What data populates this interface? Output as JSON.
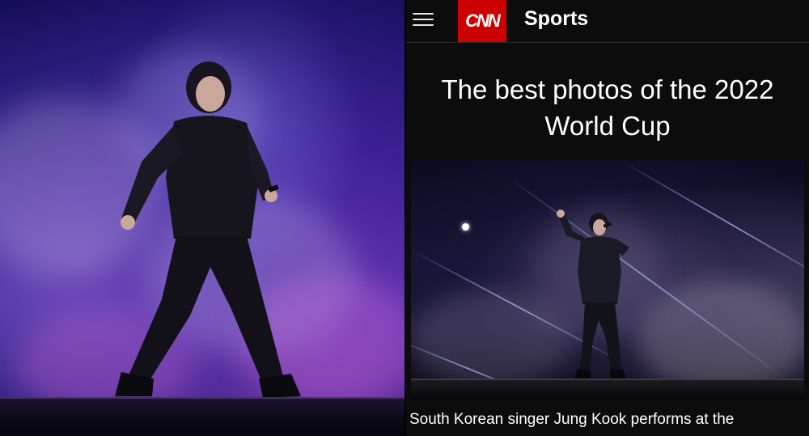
{
  "header": {
    "menu_icon": "hamburger-menu-icon",
    "logo_text": "CNN",
    "section": "Sports",
    "brand_color": "#cc0000"
  },
  "article": {
    "headline": "The best photos of the 2022 World Cup",
    "caption": "South Korean singer Jung Kook performs at the"
  },
  "colors": {
    "background": "#0c0c0c",
    "text": "#ffffff"
  }
}
